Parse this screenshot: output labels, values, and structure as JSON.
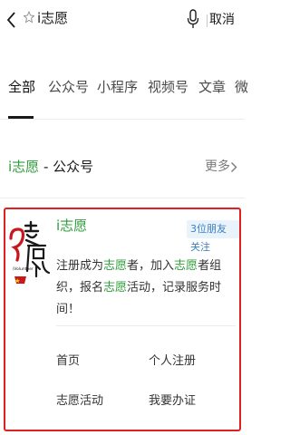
{
  "search": {
    "query": "i志愿",
    "cancel_label": "取消"
  },
  "tabs": [
    {
      "label": "全部"
    },
    {
      "label": "公众号"
    },
    {
      "label": "小程序"
    },
    {
      "label": "视频号"
    },
    {
      "label": "文章"
    },
    {
      "label": "微"
    }
  ],
  "section": {
    "title_highlight": "i志愿",
    "title_rest": " - 公众号",
    "more_label": "更多"
  },
  "account": {
    "name": "i志愿",
    "friends_badge": "3位朋友关注",
    "desc_parts": [
      "注册成为",
      "志愿",
      "者，加入",
      "志愿",
      "者组织，报名",
      "志愿",
      "活动，记录服务时间！"
    ],
    "logo_caption": "iVolunteer",
    "menu": [
      {
        "label": "首页"
      },
      {
        "label": "个人注册"
      },
      {
        "label": "志愿活动"
      },
      {
        "label": "我要办证"
      }
    ]
  },
  "colors": {
    "accent_green": "#2e9c3a",
    "highlight_border": "#e02020",
    "badge_blue": "#3a7fc1"
  }
}
